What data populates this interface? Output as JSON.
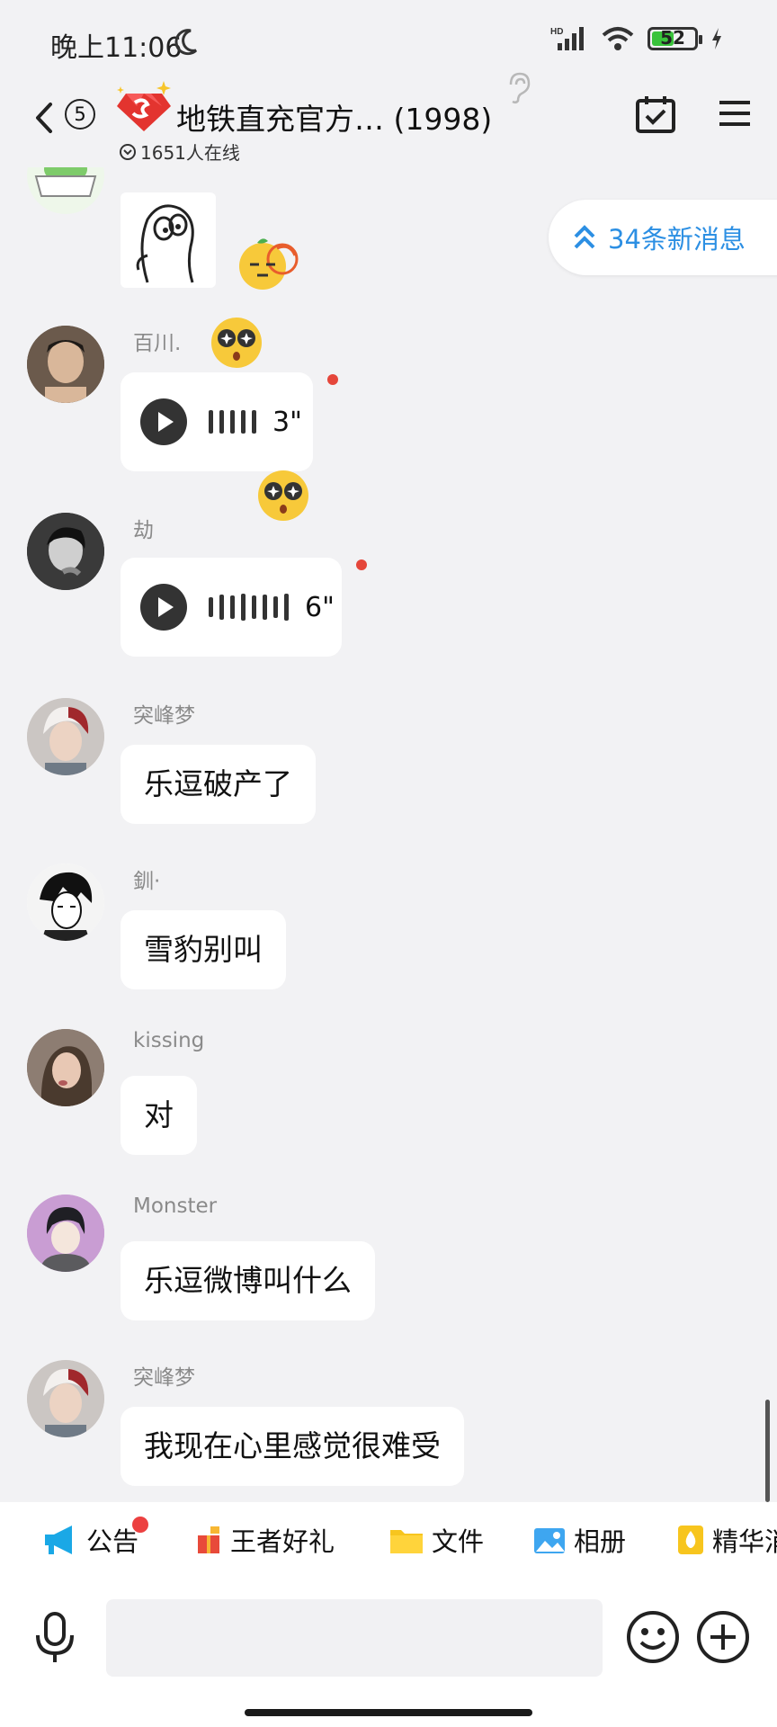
{
  "status_bar": {
    "time": "晚上11:06",
    "battery": 52,
    "network": "HD"
  },
  "header": {
    "unread_count": "5",
    "title": "地铁直充官方… (1998)",
    "online": "1651人在线",
    "icons": [
      "back-icon",
      "ear-icon",
      "calendar-check-icon",
      "menu-icon"
    ]
  },
  "new_messages_pill": "34条新消息",
  "messages": [
    {
      "sender": "百川.",
      "type": "voice",
      "duration": "3\""
    },
    {
      "sender": "劫",
      "type": "voice",
      "duration": "6\""
    },
    {
      "sender": "突峰梦",
      "type": "text",
      "text": "乐逗破产了"
    },
    {
      "sender": "釧·",
      "type": "text",
      "text": "雪豹别叫"
    },
    {
      "sender": "kissing",
      "type": "text",
      "text": "对"
    },
    {
      "sender": "Monster",
      "type": "text",
      "text": "乐逗微博叫什么"
    },
    {
      "sender": "突峰梦",
      "type": "text",
      "text": "我现在心里感觉很难受"
    }
  ],
  "quick_bar": [
    {
      "label": "公告",
      "icon": "megaphone-icon"
    },
    {
      "label": "王者好礼",
      "icon": "gift-icon"
    },
    {
      "label": "文件",
      "icon": "folder-icon"
    },
    {
      "label": "相册",
      "icon": "photo-icon"
    },
    {
      "label": "精华消",
      "icon": "essence-icon"
    }
  ],
  "input_bar": {
    "placeholder": "",
    "icons": [
      "microphone-icon",
      "emoji-icon",
      "plus-icon"
    ]
  },
  "colors": {
    "accent": "#2c8fe3",
    "background": "#f2f2f4",
    "unread_dot": "#e5463a"
  }
}
